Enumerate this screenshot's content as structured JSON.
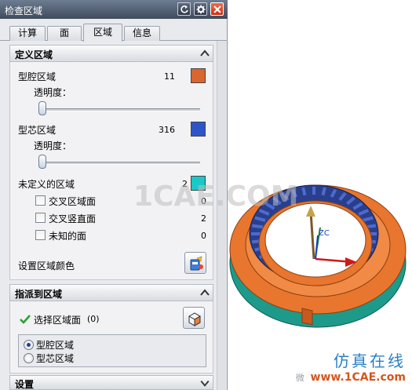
{
  "dialog": {
    "title": "检查区域",
    "tabs": [
      "计算",
      "面",
      "区域",
      "信息"
    ],
    "active_tab": "区域"
  },
  "define_regions": {
    "header": "定义区域",
    "cavity": {
      "label": "型腔区域",
      "count": "11",
      "color": "#d9652f"
    },
    "transparency_label_1": "透明度：",
    "transparency_1": 0.0,
    "core": {
      "label": "型芯区域",
      "count": "316",
      "color": "#2e55c8"
    },
    "transparency_label_2": "透明度：",
    "transparency_2": 0.0,
    "undefined": {
      "label": "未定义的区域",
      "count": "2",
      "color": "#1ac8c8"
    },
    "sub_items": [
      {
        "label": "交叉区域面",
        "count": "0"
      },
      {
        "label": "交叉竖直面",
        "count": "2"
      },
      {
        "label": "未知的面",
        "count": "0"
      }
    ],
    "set_color_label": "设置区域颜色"
  },
  "assign_regions": {
    "header": "指派到区域",
    "select_label": "选择区域面",
    "select_count": "(0)",
    "options": [
      "型腔区域",
      "型芯区域"
    ],
    "selected_option": "型腔区域"
  },
  "settings": {
    "header": "设置"
  },
  "viewport": {
    "watermark": "1CAE.COM",
    "axis_label": "ZC",
    "brand_cn": "仿真在线",
    "brand_url": "www.1CAE.com",
    "wechat_glyph": "微"
  },
  "colors": {
    "ring_orange": "#e8762e",
    "ring_teal": "#1d9a8a",
    "ring_blue": "#2a3f8c"
  }
}
